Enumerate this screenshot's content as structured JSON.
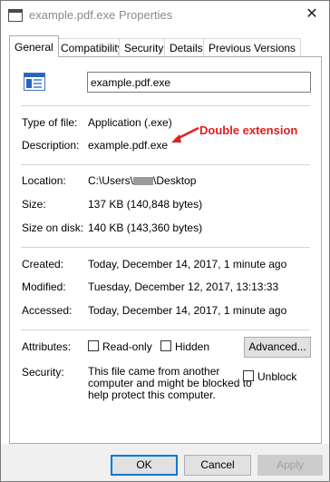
{
  "window": {
    "title": "example.pdf.exe Properties",
    "close_glyph": "✕"
  },
  "tabs": [
    {
      "label": "General",
      "active": true
    },
    {
      "label": "Compatibility",
      "active": false
    },
    {
      "label": "Security",
      "active": false
    },
    {
      "label": "Details",
      "active": false
    },
    {
      "label": "Previous Versions",
      "active": false
    }
  ],
  "general": {
    "file_name": "example.pdf.exe",
    "type_label": "Type of file:",
    "type_value": "Application (.exe)",
    "description_label": "Description:",
    "description_value": "example.pdf.exe",
    "annotation": "Double extension",
    "location_label": "Location:",
    "location_prefix": "C:\\Users\\",
    "location_suffix": "\\Desktop",
    "size_label": "Size:",
    "size_value": "137 KB (140,848 bytes)",
    "size_on_disk_label": "Size on disk:",
    "size_on_disk_value": "140 KB (143,360 bytes)",
    "created_label": "Created:",
    "created_value": "Today, December 14, 2017, 1 minute ago",
    "modified_label": "Modified:",
    "modified_value": "Tuesday, December 12, 2017, 13:13:33",
    "accessed_label": "Accessed:",
    "accessed_value": "Today, December 14, 2017, 1 minute ago",
    "attributes_label": "Attributes:",
    "readonly_label": "Read-only",
    "readonly_checked": false,
    "hidden_label": "Hidden",
    "hidden_checked": false,
    "advanced_label": "Advanced...",
    "security_label": "Security:",
    "security_text": [
      "This file came from another",
      "computer and might be blocked to",
      "help protect this computer."
    ],
    "unblock_label": "Unblock",
    "unblock_checked": false
  },
  "footer": {
    "ok_label": "OK",
    "cancel_label": "Cancel",
    "apply_label": "Apply"
  },
  "colors": {
    "annotation": "#e02020",
    "accent": "#0078d7"
  }
}
